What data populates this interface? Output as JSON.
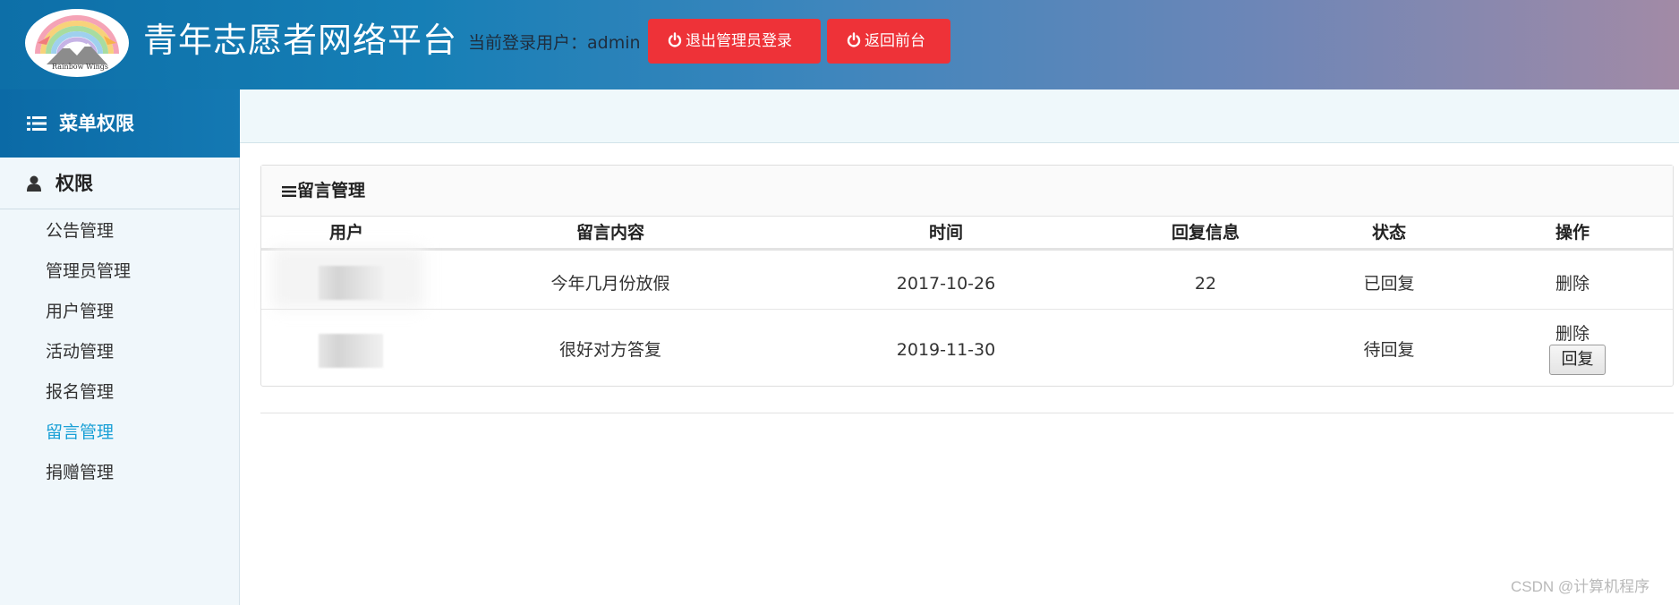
{
  "header": {
    "site_title": "青年志愿者网络平台",
    "login_label": "当前登录用户：admin",
    "logout_button": "退出管理员登录",
    "front_button": "返回前台",
    "logo_text": "Rainbow Wings",
    "button_color": "#ee3238"
  },
  "sidebar": {
    "menu_title": "菜单权限",
    "section_title": "权限",
    "items": [
      {
        "label": "公告管理",
        "active": false
      },
      {
        "label": "管理员管理",
        "active": false
      },
      {
        "label": "用户管理",
        "active": false
      },
      {
        "label": "活动管理",
        "active": false
      },
      {
        "label": "报名管理",
        "active": false
      },
      {
        "label": "留言管理",
        "active": true
      },
      {
        "label": "捐赠管理",
        "active": false
      }
    ]
  },
  "panel": {
    "title": "留言管理",
    "columns": [
      "用户",
      "留言内容",
      "时间",
      "回复信息",
      "状态",
      "操作"
    ],
    "rows": [
      {
        "user": "",
        "content": "今年几月份放假",
        "time": "2017-10-26",
        "reply": "22",
        "status": "已回复",
        "actions": [
          "删除"
        ]
      },
      {
        "user": "",
        "content": "很好对方答复",
        "time": "2019-11-30",
        "reply": "",
        "status": "待回复",
        "actions": [
          "删除",
          "回复"
        ]
      }
    ]
  },
  "watermark": "CSDN @计算机程序",
  "colors": {
    "accent": "#1aa0d6",
    "header_start": "#0d6fa8",
    "header_end": "#a28aa6"
  }
}
